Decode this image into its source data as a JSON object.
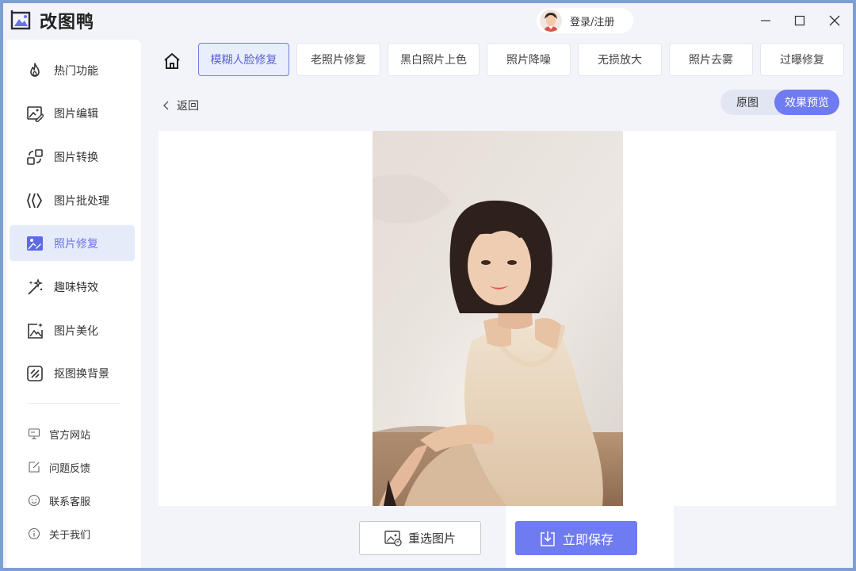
{
  "app": {
    "title": "改图鸭"
  },
  "header": {
    "login_label": "登录/注册"
  },
  "sidebar": {
    "items": [
      {
        "label": "热门功能",
        "icon": "fire-icon",
        "active": false
      },
      {
        "label": "图片编辑",
        "icon": "image-edit-icon",
        "active": false
      },
      {
        "label": "图片转换",
        "icon": "convert-icon",
        "active": false
      },
      {
        "label": "图片批处理",
        "icon": "batch-icon",
        "active": false
      },
      {
        "label": "照片修复",
        "icon": "photo-repair-icon",
        "active": true
      },
      {
        "label": "趣味特效",
        "icon": "magic-wand-icon",
        "active": false
      },
      {
        "label": "图片美化",
        "icon": "beautify-icon",
        "active": false
      },
      {
        "label": "抠图换背景",
        "icon": "cutout-icon",
        "active": false
      }
    ],
    "links": [
      {
        "label": "官方网站",
        "icon": "monitor-icon"
      },
      {
        "label": "问题反馈",
        "icon": "feedback-icon"
      },
      {
        "label": "联系客服",
        "icon": "support-icon"
      },
      {
        "label": "关于我们",
        "icon": "info-icon"
      }
    ]
  },
  "tabs": [
    {
      "label": "模糊人脸修复",
      "active": true
    },
    {
      "label": "老照片修复",
      "active": false
    },
    {
      "label": "黑白照片上色",
      "active": false
    },
    {
      "label": "照片降噪",
      "active": false
    },
    {
      "label": "无损放大",
      "active": false
    },
    {
      "label": "照片去雾",
      "active": false
    },
    {
      "label": "过曝修复",
      "active": false
    }
  ],
  "toolbar": {
    "back_label": "返回"
  },
  "view_toggle": {
    "original_label": "原图",
    "preview_label": "效果预览",
    "selected": "效果预览"
  },
  "actions": {
    "reselect_label": "重选图片",
    "save_label": "立即保存"
  },
  "colors": {
    "accent": "#6f7bf0",
    "active_tab_bg": "#e8eefc",
    "sidebar_active_bg": "#e6ebfa",
    "window_border": "#7e9fd6"
  }
}
